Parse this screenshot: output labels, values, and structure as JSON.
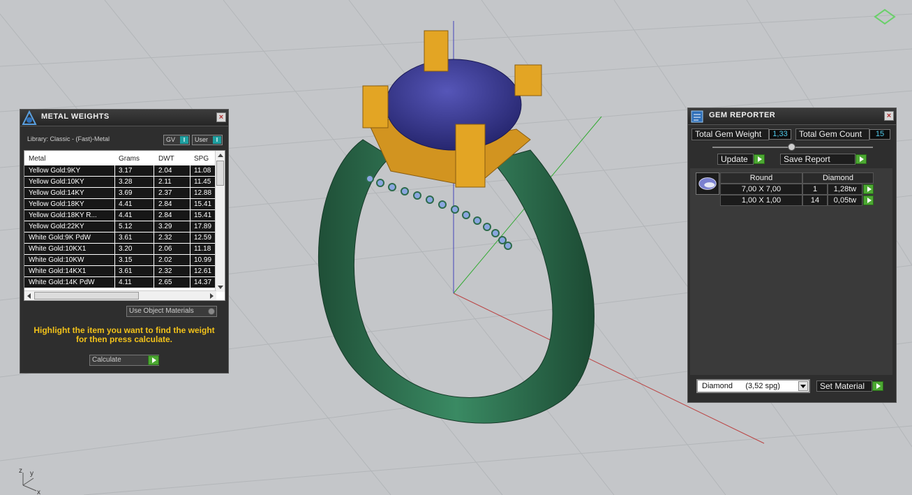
{
  "metal_weights": {
    "title": "METAL WEIGHTS",
    "library": "Library: Classic - (Fast)-Metal",
    "toggle_gv": "GV",
    "toggle_user": "User",
    "columns": [
      "Metal",
      "Grams",
      "DWT",
      "SPG"
    ],
    "rows": [
      [
        "Yellow Gold:9KY",
        "3.17",
        "2.04",
        "11.08"
      ],
      [
        "Yellow Gold:10KY",
        "3.28",
        "2.11",
        "11.45"
      ],
      [
        "Yellow Gold:14KY",
        "3.69",
        "2.37",
        "12.88"
      ],
      [
        "Yellow Gold:18KY",
        "4.41",
        "2.84",
        "15.41"
      ],
      [
        "Yellow Gold:18KY R...",
        "4.41",
        "2.84",
        "15.41"
      ],
      [
        "Yellow Gold:22KY",
        "5.12",
        "3.29",
        "17.89"
      ],
      [
        "White Gold:9K PdW",
        "3.61",
        "2.32",
        "12.59"
      ],
      [
        "White Gold:10KX1",
        "3.20",
        "2.06",
        "11.18"
      ],
      [
        "White Gold:10KW",
        "3.15",
        "2.02",
        "10.99"
      ],
      [
        "White Gold:14KX1",
        "3.61",
        "2.32",
        "12.61"
      ],
      [
        "White Gold:14K PdW",
        "4.11",
        "2.65",
        "14.37"
      ]
    ],
    "use_object_materials": "Use Object Materials",
    "hint": "Highlight the item you want to find the weight for then press calculate.",
    "calculate": "Calculate"
  },
  "gem_reporter": {
    "title": "GEM REPORTER",
    "total_gem_weight_label": "Total Gem Weight",
    "total_gem_weight_value": "1,33",
    "total_gem_count_label": "Total Gem Count",
    "total_gem_count_value": "15",
    "update": "Update",
    "save_report": "Save Report",
    "shape": "Round",
    "material": "Diamond",
    "rows": [
      [
        "7,00 X 7,00",
        "1",
        "1,28tw"
      ],
      [
        "1,00 X 1,00",
        "14",
        "0,05tw"
      ]
    ],
    "material_select": "Diamond      (3,52 spg)",
    "set_material": "Set Material"
  },
  "axis": {
    "z": "z",
    "y": "y",
    "x": "x"
  },
  "colors": {
    "band": "#2d6b4c",
    "prongs": "#e3a524",
    "gem": "#3a3a8c",
    "hint": "#f2c21a",
    "accent_green": "#4ca832"
  }
}
